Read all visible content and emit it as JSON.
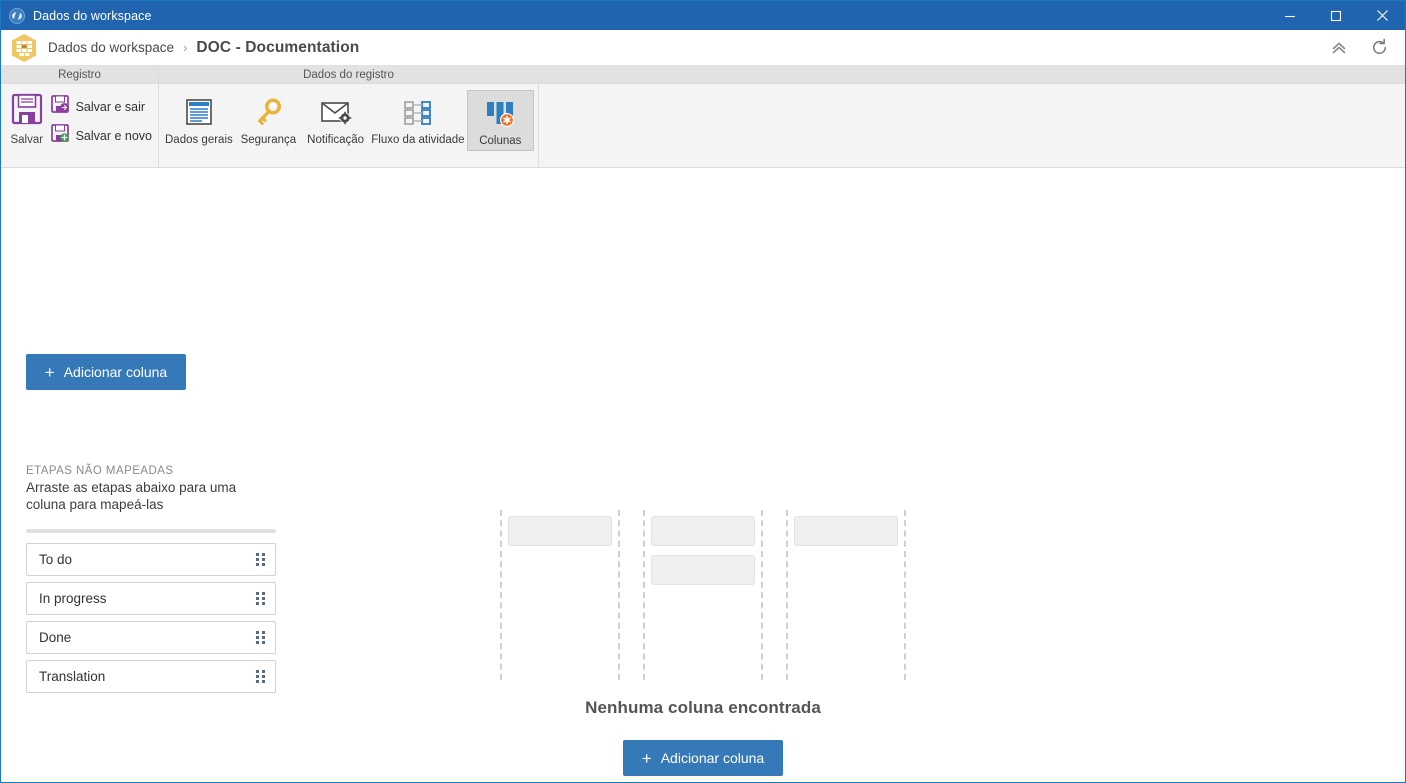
{
  "window": {
    "title": "Dados do workspace",
    "app_icon": "workspace-globe-icon",
    "controls": {
      "minimize": "minimize-icon",
      "maximize": "maximize-icon",
      "close": "close-icon"
    }
  },
  "header": {
    "logo_icon": "workspace-hexagon-logo",
    "breadcrumb_root": "Dados do workspace",
    "breadcrumb_separator": "›",
    "page_title": "DOC - Documentation",
    "actions": [
      {
        "name": "collapse-ribbon-icon",
        "label": "collapse-ribbon"
      },
      {
        "name": "refresh-icon",
        "label": "refresh"
      }
    ]
  },
  "ribbon": {
    "groups": [
      {
        "title": "Registro",
        "primary_button": {
          "label": "Salvar",
          "icon": "save-floppy-icon"
        },
        "secondary_buttons": [
          {
            "label": "Salvar e sair",
            "icon": "save-and-exit-icon"
          },
          {
            "label": "Salvar e novo",
            "icon": "save-and-new-icon"
          }
        ]
      },
      {
        "title": "Dados do registro",
        "buttons": [
          {
            "label": "Dados gerais",
            "icon": "general-data-icon",
            "active": false
          },
          {
            "label": "Segurança",
            "icon": "key-icon",
            "active": false
          },
          {
            "label": "Notificação",
            "icon": "envelope-gear-icon",
            "active": false
          },
          {
            "label": "Fluxo da atividade",
            "icon": "workflow-icon",
            "active": false
          },
          {
            "label": "Colunas",
            "icon": "columns-icon",
            "active": true
          }
        ]
      }
    ]
  },
  "main": {
    "add_column_top_label": "Adicionar coluna",
    "add_column_plus": "+",
    "unmapped": {
      "kicker": "ETAPAS NÃO MAPEADAS",
      "description": "Arraste as etapas abaixo para uma coluna para mapeá-las",
      "stages": [
        {
          "name": "To do",
          "handle_icon": "drag-handle-icon"
        },
        {
          "name": "In progress",
          "handle_icon": "drag-handle-icon"
        },
        {
          "name": "Done",
          "handle_icon": "drag-handle-icon"
        },
        {
          "name": "Translation",
          "handle_icon": "drag-handle-icon"
        }
      ]
    },
    "empty_state": {
      "placeholder_columns": [
        1,
        2,
        1
      ],
      "title": "Nenhuma coluna encontrada",
      "add_column_label": "Adicionar coluna",
      "add_column_plus": "+"
    }
  },
  "colors": {
    "titlebar_blue": "#2064b0",
    "primary_blue": "#3579b8",
    "window_border": "#1a78c2",
    "ribbon_bg": "#f4f4f4",
    "group_header_bg": "#e2e2e2",
    "save_purple": "#8a3f9e",
    "key_gold": "#e8b33a",
    "columns_blue": "#2d7fc1",
    "badge_orange": "#f07020"
  }
}
